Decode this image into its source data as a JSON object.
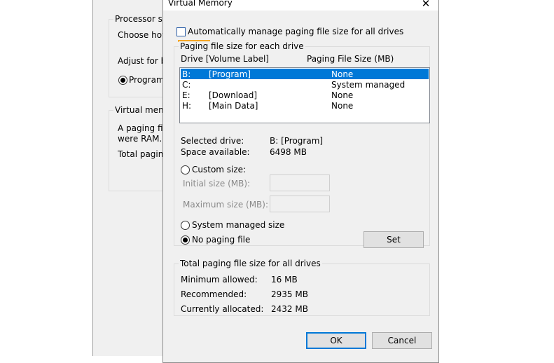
{
  "background_window": {
    "processor_group_title": "Processor sch",
    "choose_text": "Choose how",
    "adjust_text": "Adjust for be",
    "programs_radio_label": "Programs",
    "virtual_memory_group_title": "Virtual memo",
    "paging_line1": "A paging file",
    "paging_line2": "were RAM.",
    "total_paging_text": "Total paging"
  },
  "dialog": {
    "title": "Virtual Memory",
    "close_glyph": "✕",
    "auto_manage_label": "Automatically manage paging file size for all drives",
    "auto_manage_checked": false,
    "each_drive_group_title": "Paging file size for each drive",
    "columns": {
      "drive": "Drive  [Volume Label]",
      "size": "Paging File Size (MB)"
    },
    "drives": [
      {
        "letter": "B:",
        "label": "[Program]",
        "size": "None",
        "selected": true
      },
      {
        "letter": "C:",
        "label": "",
        "size": "System managed",
        "selected": false
      },
      {
        "letter": "E:",
        "label": "[Download]",
        "size": "None",
        "selected": false
      },
      {
        "letter": "H:",
        "label": "[Main Data]",
        "size": "None",
        "selected": false
      }
    ],
    "selected_drive_label": "Selected drive:",
    "selected_drive_value": "B:  [Program]",
    "space_available_label": "Space available:",
    "space_available_value": "6498 MB",
    "custom_size_label": "Custom size:",
    "initial_size_label": "Initial size (MB):",
    "maximum_size_label": "Maximum size (MB):",
    "system_managed_label": "System managed size",
    "no_paging_label": "No paging file",
    "selected_option": "no_paging",
    "set_button": "Set",
    "total_group_title": "Total paging file size for all drives",
    "minimum_allowed_label": "Minimum allowed:",
    "minimum_allowed_value": "16 MB",
    "recommended_label": "Recommended:",
    "recommended_value": "2935 MB",
    "currently_allocated_label": "Currently allocated:",
    "currently_allocated_value": "2432 MB",
    "ok_button": "OK",
    "cancel_button": "Cancel"
  },
  "colors": {
    "selection": "#0078d7",
    "highlight_underline": "#f5a623",
    "dialog_bg": "#f0f0f0"
  }
}
